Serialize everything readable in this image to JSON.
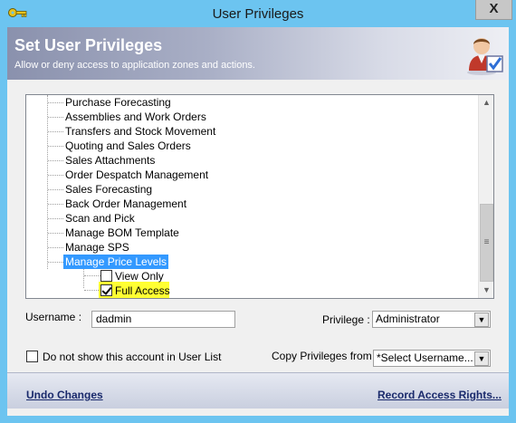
{
  "window": {
    "title": "User Privileges",
    "close_glyph": "X"
  },
  "banner": {
    "title": "Set User Privileges",
    "subtitle": "Allow or deny access to application zones and actions."
  },
  "tree": {
    "items": [
      {
        "label": "Purchase Forecasting"
      },
      {
        "label": "Assemblies and Work Orders"
      },
      {
        "label": "Transfers and Stock Movement"
      },
      {
        "label": "Quoting and Sales Orders"
      },
      {
        "label": "Sales Attachments"
      },
      {
        "label": "Order Despatch Management"
      },
      {
        "label": "Sales Forecasting"
      },
      {
        "label": "Back Order Management"
      },
      {
        "label": "Scan and Pick"
      },
      {
        "label": "Manage BOM Template"
      },
      {
        "label": "Manage SPS"
      },
      {
        "label": "Manage Price Levels",
        "selected": true
      }
    ],
    "children": [
      {
        "label": "View Only",
        "checked": false
      },
      {
        "label": "Full Access",
        "checked": true,
        "highlighted": true
      }
    ],
    "scroll_thumb_glyph": "≡"
  },
  "form": {
    "username_label": "Username :",
    "username_value": "dadmin",
    "privilege_label": "Privilege :",
    "privilege_value": "Administrator",
    "hide_account_label": "Do not show this account in User List",
    "hide_account_checked": false,
    "copy_label": "Copy Privileges from :",
    "copy_value": "*Select Username..."
  },
  "footer": {
    "undo_label": "Undo Changes",
    "record_label": "Record Access Rights..."
  },
  "colors": {
    "titlebar": "#6cc4f0",
    "selection": "#3399ff",
    "highlight": "#ffff33"
  }
}
